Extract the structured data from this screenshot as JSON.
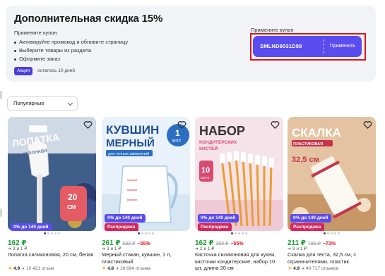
{
  "promo": {
    "title": "Дополнительная скидка 15%",
    "subtitle": "Примените купон",
    "steps": [
      "Активируйте промокод и обновите страницу",
      "Выберите товары из раздела",
      "Оформите заказ"
    ],
    "tag": "Акция",
    "days_left": "осталось 10 дней",
    "coupon_label": "Примените купон",
    "coupon_code": "SMLND8031D98",
    "apply_label": "Применить"
  },
  "sort": {
    "selected": "Популярные"
  },
  "products": [
    {
      "price": "162 ₽",
      "old_price": "",
      "discount": "",
      "split": "3 и 1 ₽",
      "title": "Лопатка силиконовая, 20 см, белая",
      "rating": "4.9",
      "reviews": "10 421 отзыв",
      "badge": "0% до 140 дней",
      "badge_type": "installment",
      "thumb_text": [
        "ЛОПАТКА",
        "кухонная",
        "20",
        "СМ"
      ]
    },
    {
      "price": "261 ₽",
      "old_price": "580 ₽",
      "discount": "−55%",
      "split": "3 и 1 ₽",
      "title": "Мерный стакан, кувшин, 1 л, пластиковый",
      "rating": "4.8",
      "reviews": "28 694 отзыва",
      "badge": "0% до 140 дней",
      "badge2": "Распродажа",
      "badge_type": "sale",
      "thumb_text": [
        "КУВШИН",
        "МЕРНЫЙ",
        "для точных измерений",
        "1",
        "ЛИТР"
      ]
    },
    {
      "price": "162 ₽",
      "old_price": "360 ₽",
      "discount": "−55%",
      "split": "2 и 1 ₽",
      "title": "Кисточка силиконовая для кухни, кисточки кондитерские, набор 10 шт, длина 20 см",
      "rating": "",
      "reviews": "",
      "badge": "0% до 140 дней",
      "badge2": "Распродажа",
      "badge_type": "sale",
      "thumb_text": [
        "НАБОР",
        "КОНДИТЕРСКИХ",
        "КИСТЕЙ",
        "10",
        "ШТУК"
      ]
    },
    {
      "price": "211 ₽",
      "old_price": "796 ₽",
      "discount": "−73%",
      "split": "3 и 1 ₽",
      "title": "Скалка для теста, 32,5 см, с ограничителями, пластик",
      "rating": "4.9",
      "reviews": "40 717 отзывов",
      "badge": "0% до 140 дней",
      "badge2": "Распродажа",
      "badge_type": "sale",
      "thumb_text": [
        "СКАЛКА",
        "ПЛАСТИКОВАЯ",
        "32,5 см"
      ]
    }
  ],
  "colors": {
    "accent": "#5b4cf0",
    "price_green": "#1a9e32",
    "sale_red": "#e0141b",
    "sale_badge": "#d7265e",
    "highlight": "#e0141b"
  }
}
